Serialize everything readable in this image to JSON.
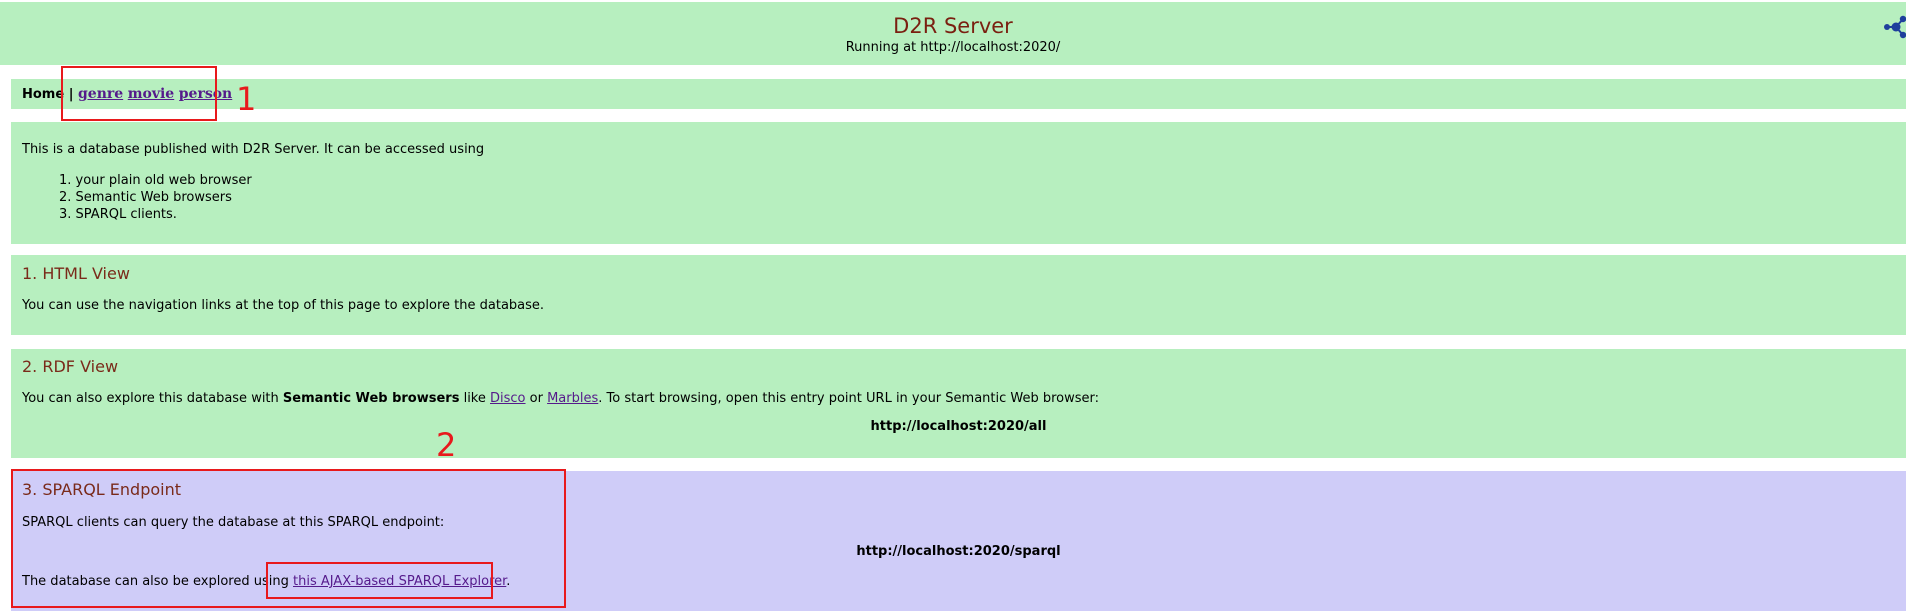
{
  "header": {
    "title": "D2R Server",
    "subtitle": "Running at http://localhost:2020/"
  },
  "nav": {
    "home": "Home",
    "separator": "|",
    "links": [
      "genre",
      "movie",
      "person"
    ]
  },
  "intro": {
    "text": "This is a database published with D2R Server. It can be accessed using",
    "items": [
      "1. your plain old web browser",
      "2. Semantic Web browsers",
      "3. SPARQL clients."
    ]
  },
  "html_view": {
    "heading": "1. HTML View",
    "text": "You can use the navigation links at the top of this page to explore the database."
  },
  "rdf_view": {
    "heading": "2. RDF View",
    "text_a": "You can also explore this database with ",
    "text_bold": "Semantic Web browsers",
    "text_b": " like ",
    "link_disco": "Disco",
    "text_c": " or ",
    "link_marbles": "Marbles",
    "text_d": ". To start browsing, open this entry point URL in your Semantic Web browser:",
    "entry_url": "http://localhost:2020/all"
  },
  "sparql": {
    "heading": "3. SPARQL Endpoint",
    "text": "SPARQL clients can query the database at this SPARQL endpoint:",
    "endpoint_url": "http://localhost:2020/sparql",
    "explore_text_a": "The database can also be explored using ",
    "explore_link": "this AJAX-based SPARQL Explorer",
    "explore_text_b": "."
  },
  "annotations": {
    "label_1": "1",
    "label_2": "2",
    "color": "#e8191c"
  },
  "colors": {
    "green_band": "#b7efbf",
    "purple_band": "#cfccf8",
    "title": "#7a1f10"
  }
}
